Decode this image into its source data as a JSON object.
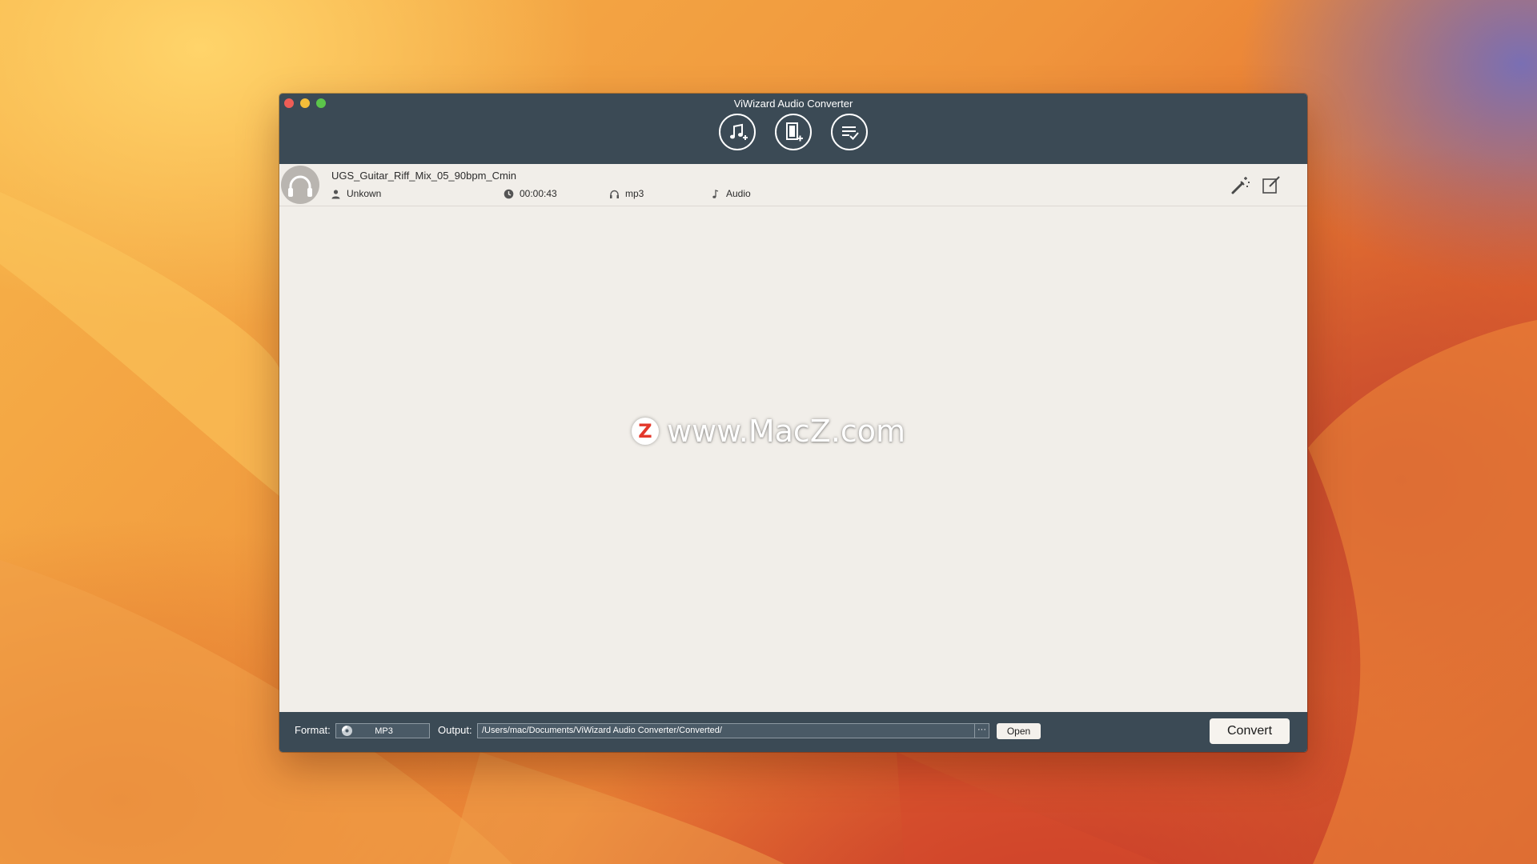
{
  "window": {
    "title": "ViWizard Audio Converter"
  },
  "toolbar": {
    "buttons": [
      {
        "icon": "add-music-icon"
      },
      {
        "icon": "add-file-icon"
      },
      {
        "icon": "converted-list-icon"
      }
    ]
  },
  "file": {
    "name": "UGS_Guitar_Riff_Mix_05_90bpm_Cmin",
    "artist": "Unkown",
    "duration": "00:00:43",
    "format": "mp3",
    "type": "Audio"
  },
  "watermark": {
    "logo_letter": "Z",
    "text": "www.MacZ.com"
  },
  "bottom": {
    "format_label": "Format:",
    "format_value": "MP3",
    "output_label": "Output:",
    "output_path": "/Users/mac/Documents/ViWizard Audio Converter/Converted/",
    "more_label": "···",
    "open_label": "Open",
    "convert_label": "Convert"
  },
  "colors": {
    "titlebar": "#3b4a55",
    "content_bg": "#f1eee9",
    "close": "#ee5d56",
    "minimize": "#f4bd39",
    "zoom": "#5bc54a"
  }
}
